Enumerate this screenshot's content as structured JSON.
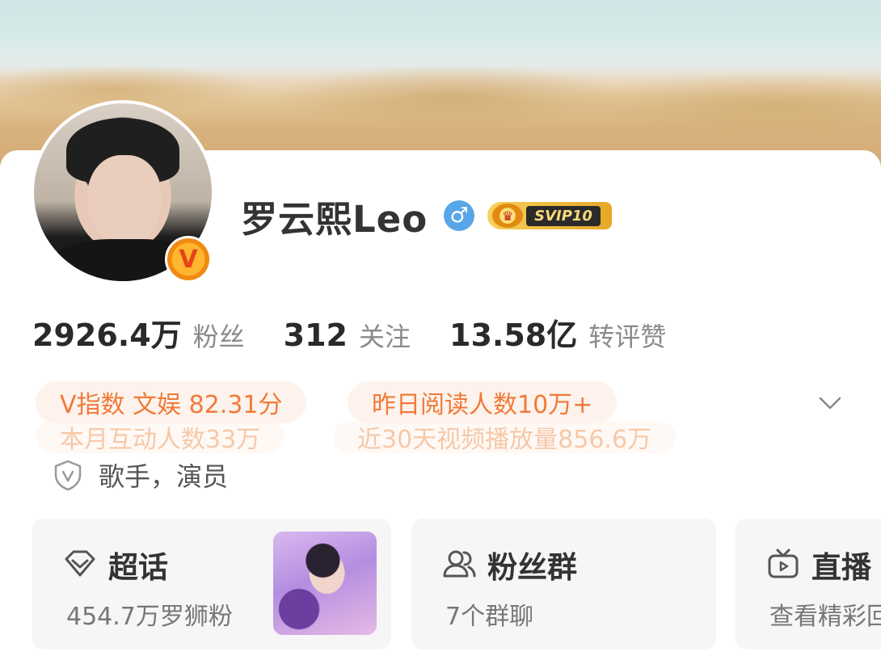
{
  "profile": {
    "name": "罗云熙Leo",
    "gender_symbol": "♂",
    "vip_label": "SVIP10",
    "verified_badge": "V"
  },
  "stats": [
    {
      "value": "2926.4万",
      "label": "粉丝"
    },
    {
      "value": "312",
      "label": "关注"
    },
    {
      "value": "13.58亿",
      "label": "转评赞"
    }
  ],
  "tags": {
    "v_index": "V指数 文娱 82.31分",
    "yesterday_reads": "昨日阅读人数10万+",
    "monthly_interactions": "本月互动人数33万",
    "video_plays": "近30天视频播放量856.6万"
  },
  "identity": "歌手，演员",
  "cards": [
    {
      "title": "超话",
      "subtitle": "454.7万罗狮粉",
      "icon": "diamond-icon"
    },
    {
      "title": "粉丝群",
      "subtitle": "7个群聊",
      "icon": "people-icon"
    },
    {
      "title": "直播",
      "subtitle": "查看精彩回",
      "icon": "tv-icon"
    }
  ],
  "colors": {
    "accent_orange": "#f07a3a",
    "tag_bg": "#fdf3ec",
    "gender_blue": "#58a6e8",
    "card_bg": "#f6f6f6"
  }
}
